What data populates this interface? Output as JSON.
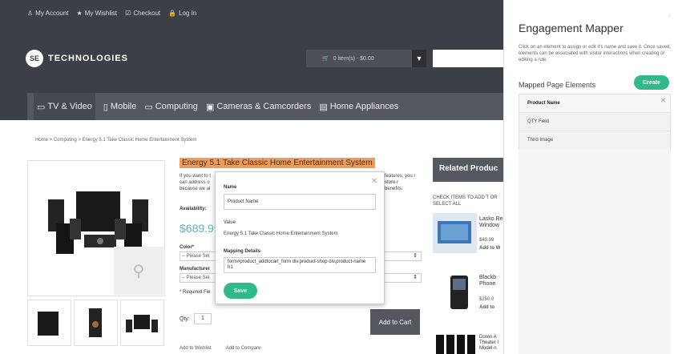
{
  "topbar": {
    "links": [
      {
        "icon": "person-icon",
        "label": "My Account"
      },
      {
        "icon": "star-icon",
        "label": "My Wishlist"
      },
      {
        "icon": "checkbox-icon",
        "label": "Checkout"
      },
      {
        "icon": "lock-icon",
        "label": "Log In"
      }
    ]
  },
  "logo": {
    "badge": "SE",
    "name": "TECHNOLOGIES"
  },
  "cart": {
    "label": "0 item(s) - $0.00"
  },
  "nav": [
    "TV & Video",
    "Mobile",
    "Computing",
    "Cameras & Camcorders",
    "Home Appliances"
  ],
  "breadcrumb": "Home  >  Computing  >  Energy 5.1 Take Classic Home Entertainment System",
  "product": {
    "title": "Energy 5.1 Take Classic Home Entertainment System",
    "desc_left": "If you want to t can address o because we al",
    "desc_right": "features, you r store r benefits.",
    "availability": "Availability:",
    "price": "$689.99",
    "color_label": "Color*",
    "color_placeholder": "-- Please Sel",
    "manufacturer_label": "Manufacturer",
    "manufacturer_placeholder": "-- Please Sel",
    "required": "* Required Fie",
    "qty_label": "Qty:",
    "qty_value": "1",
    "add_to_cart": "Add to Cart",
    "add_to_wishlist": "Add to Wishlist",
    "add_to_compare": "Add to Compare"
  },
  "related": {
    "title": "Related Produc",
    "hint": "CHECK ITEMS TO ADD T OR SELECT ALL",
    "items": [
      {
        "name": "Lasko Re Window",
        "price": "$49.99",
        "action": "Add to W"
      },
      {
        "name": "Blackb Phone",
        "price": "$250.0",
        "action": "Add to"
      },
      {
        "name": "Doren A Theater I Model-n",
        "price": "",
        "action": ""
      }
    ]
  },
  "popup": {
    "name_label": "Name",
    "name_value": "Product Name",
    "value_label": "Value",
    "value_text": "Energy 5.1 Take Classic Home Entertainment System",
    "mapping_label": "Mapping Details",
    "mapping_value": "form#product_addtocart_form div.product-shop div.product-name h1",
    "save_label": "Save"
  },
  "panel": {
    "title": "Engagement Mapper",
    "description": "Click on an element to assign or edit it's name and save it. Once saved, elements can be associated with visitor interactions when creating or editing a rule.",
    "subtitle": "Mapped Page Elements",
    "create_label": "Create",
    "items": [
      "Product Name",
      "QTY Field",
      "Third Image"
    ]
  },
  "colors": {
    "accent": "#30b98a",
    "highlight": "#f39a55",
    "price": "#5cb8b2",
    "header": "#3c3f45"
  }
}
